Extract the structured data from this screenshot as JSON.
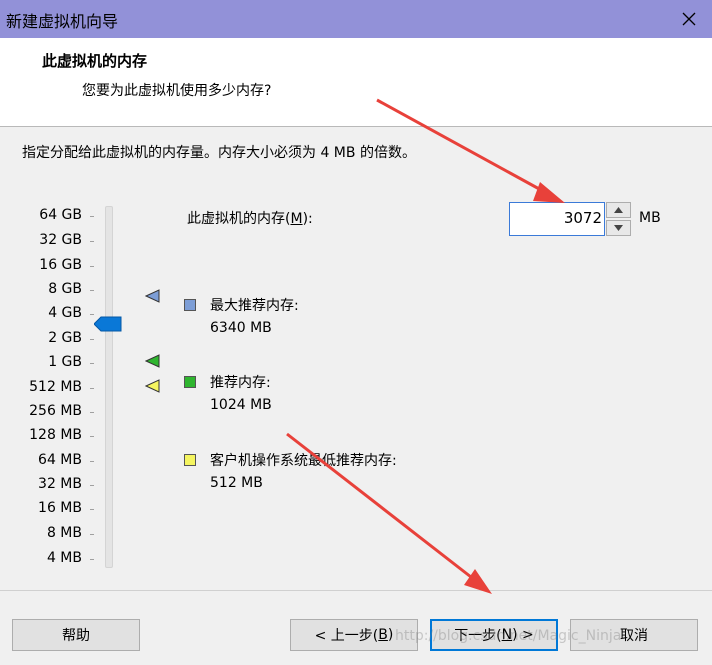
{
  "window": {
    "title": "新建虚拟机向导"
  },
  "header": {
    "title": "此虚拟机的内存",
    "subtitle": "您要为此虚拟机使用多少内存?"
  },
  "hint": "指定分配给此虚拟机的内存量。内存大小必须为 4 MB 的倍数。",
  "scale": [
    "64 GB",
    "32 GB",
    "16 GB",
    "8 GB",
    "4 GB",
    "2 GB",
    "1 GB",
    "512 MB",
    "256 MB",
    "128 MB",
    "64 MB",
    "32 MB",
    "16 MB",
    "8 MB",
    "4 MB"
  ],
  "memory": {
    "label_prefix": "此虚拟机的内存(",
    "label_key": "M",
    "label_suffix": "):",
    "value": "3072",
    "unit": "MB"
  },
  "legend": [
    {
      "label": "最大推荐内存:",
      "value": "6340 MB",
      "color": "#7d9ed6"
    },
    {
      "label": "推荐内存:",
      "value": "1024 MB",
      "color": "#2fb52f"
    },
    {
      "label": "客户机操作系统最低推荐内存:",
      "value": "512 MB",
      "color": "#f5f560"
    }
  ],
  "buttons": {
    "help": "帮助",
    "back_prefix": "< 上一步(",
    "back_key": "B",
    "back_suffix": ")",
    "next_prefix": "下一步(",
    "next_key": "N",
    "next_suffix": ") >",
    "cancel": "取消"
  },
  "colors": {
    "titlebar": "#9291d8",
    "slider_thumb": "#0a78d7",
    "arrow": "#e8413a"
  },
  "icons": {
    "close": "close-icon",
    "spin_up": "chevron-up-icon",
    "spin_down": "chevron-down-icon"
  },
  "watermark": "http://blog.csdn.net/Magic_Ninja"
}
